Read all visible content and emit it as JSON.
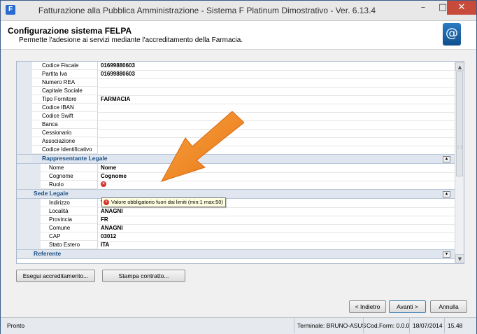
{
  "window": {
    "title": "Fatturazione alla Pubblica Amministrazione - Sistema F Platinum Dimostrativo - Ver. 6.13.4",
    "min_glyph": "–",
    "max_glyph": "□",
    "close_glyph": "✕",
    "app_icon_glyph": "F"
  },
  "header": {
    "title": "Configurazione sistema FELPA",
    "subtitle": "Permette l'adesione ai servizi mediante l'accreditamento della Farmacia.",
    "logo_glyph": "@"
  },
  "grid": {
    "top_rows": [
      {
        "label": "Codice Fiscale",
        "value": "01699880603"
      },
      {
        "label": "Partita Iva",
        "value": "01699880603"
      },
      {
        "label": "Numero REA",
        "value": ""
      },
      {
        "label": "Capitale Sociale",
        "value": ""
      },
      {
        "label": "Tipo Fornitore",
        "value": "FARMACIA"
      },
      {
        "label": "Codice IBAN",
        "value": ""
      },
      {
        "label": "Codice Swift",
        "value": ""
      },
      {
        "label": "Banca",
        "value": ""
      },
      {
        "label": "Cessionario",
        "value": ""
      },
      {
        "label": "Associazione",
        "value": ""
      },
      {
        "label": "Codice Identificativo",
        "value": ""
      }
    ],
    "rappresentante": {
      "title": "Rappresentante Legale",
      "toggle": "▴",
      "rows": [
        {
          "label": "Nome",
          "value": "Nome"
        },
        {
          "label": "Cognome",
          "value": "Cognome"
        },
        {
          "label": "Ruolo",
          "value": ""
        }
      ]
    },
    "sede": {
      "title": "Sede Legale",
      "toggle": "▴",
      "rows": [
        {
          "label": "Indirizzo",
          "value": "V"
        },
        {
          "label": "Località",
          "value": "ANAGNI"
        },
        {
          "label": "Provincia",
          "value": "FR"
        },
        {
          "label": "Comune",
          "value": "ANAGNI"
        },
        {
          "label": "CAP",
          "value": "03012"
        },
        {
          "label": "Stato Estero",
          "value": "ITA"
        }
      ]
    },
    "referente": {
      "title": "Referente",
      "toggle": "▾"
    },
    "error_glyph": "×"
  },
  "tooltip": {
    "text": "Valore obbligatorio fuori dai limiti (min:1 max:50)"
  },
  "buttons": {
    "accreditamento": "Esegui accreditamento...",
    "stampa": "Stampa contratto...",
    "indietro": "< Indietro",
    "avanti": "Avanti >",
    "annulla": "Annulla"
  },
  "status": {
    "ready": "Pronto",
    "terminal": "Terminale: BRUNO-ASUS",
    "cod_form": "Cod.Form: 0.0.0",
    "date": "18/07/2014",
    "time": "15.48"
  },
  "scrollbar": {
    "up": "▲",
    "down": "▼",
    "grip": "::"
  },
  "colors": {
    "accent_arrow": "#f08a24",
    "category_text": "#1d4f85",
    "close_button": "#c74a3b"
  }
}
